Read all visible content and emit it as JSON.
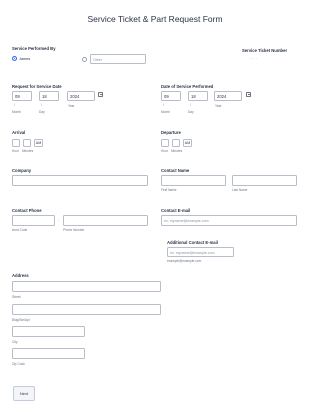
{
  "form": {
    "title": "Service Ticket & Part Request Form",
    "next_label": "Next"
  },
  "service_performed_by": {
    "label": "Service Performed By",
    "option1": "James",
    "option2_placeholder": "Other",
    "selected": "James"
  },
  "service_ticket_number": {
    "label": "Service Ticket Number",
    "value": "- - - -"
  },
  "request_date": {
    "label": "Request for Service Date",
    "month": "09",
    "day": "18",
    "year": "2024",
    "month_label": "Month",
    "day_label": "Day",
    "year_label": "Year",
    "sep": "/"
  },
  "performed_date": {
    "label": "Date of Service Performed",
    "month": "09",
    "day": "18",
    "year": "2024",
    "month_label": "Month",
    "day_label": "Day",
    "year_label": "Year",
    "sep": "/"
  },
  "arrival": {
    "label": "Arrival",
    "hour_label": "Hour",
    "minutes_label": "Minutes",
    "ampm": "AM"
  },
  "departure": {
    "label": "Departure",
    "hour_label": "Hour",
    "minutes_label": "Minutes",
    "ampm": "AM"
  },
  "company": {
    "label": "Company"
  },
  "contact_name": {
    "label": "Contact Name",
    "first_label": "First Name",
    "last_label": "Last Name"
  },
  "contact_phone": {
    "label": "Contact Phone",
    "area_label": "Area Code",
    "phone_label": "Phone Number",
    "sep": "-"
  },
  "contact_email": {
    "label": "Contact E-mail",
    "placeholder": "ex: myname@example.com"
  },
  "additional_email": {
    "label": "Additional Contact E-mail",
    "placeholder": "ex: myname@example.com",
    "sublabel": "example@example.com"
  },
  "address": {
    "label": "Address",
    "street_label": "Street",
    "street2_label": "Bldg/Ste/Apt",
    "city_label": "City",
    "zip_label": "Zip Code"
  }
}
